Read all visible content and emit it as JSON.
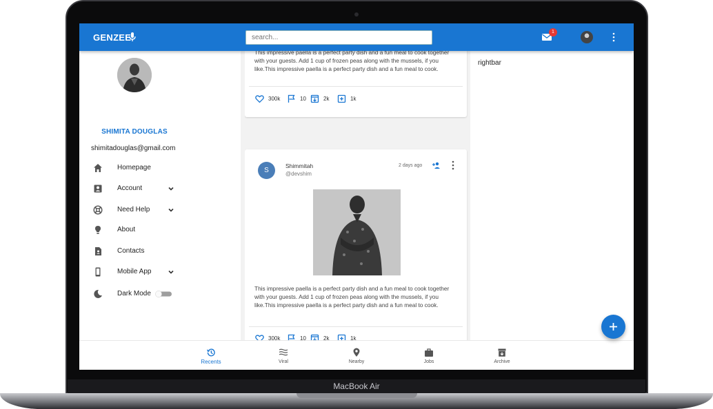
{
  "device": {
    "label": "MacBook Air"
  },
  "appbar": {
    "brand": "GENZEE",
    "search_placeholder": "search...",
    "mail_badge": "1"
  },
  "sidebar": {
    "name": "SHIMITA DOUGLAS",
    "email": "shimitadouglas@gmail.com",
    "items": [
      {
        "label": "Homepage",
        "icon": "home-icon",
        "expandable": false
      },
      {
        "label": "Account",
        "icon": "account-box-icon",
        "expandable": true
      },
      {
        "label": "Need Help",
        "icon": "help-buoy-icon",
        "expandable": true
      },
      {
        "label": "About",
        "icon": "lightbulb-icon",
        "expandable": false
      },
      {
        "label": "Contacts",
        "icon": "contact-file-icon",
        "expandable": false
      },
      {
        "label": "Mobile App",
        "icon": "smartphone-icon",
        "expandable": true
      },
      {
        "label": "Dark Mode",
        "icon": "moon-icon",
        "expandable": false
      }
    ]
  },
  "feed": {
    "post1": {
      "text": "This impressive paella is a perfect party dish and a fun meal to cook together with your guests. Add 1 cup of frozen peas along with the mussels, if you like.This impressive paella is a perfect party dish and a fun meal to cook.",
      "likes": "300k",
      "flags": "10",
      "saves": "2k",
      "adds": "1k"
    },
    "post2": {
      "avatar_letter": "S",
      "user": "Shimmitah",
      "handle": "@devshim",
      "time": "2 days ago",
      "text": "This impressive paella is a perfect party dish and a fun meal to cook together with your guests. Add 1 cup of frozen peas along with the mussels, if you like.This impressive paella is a perfect party dish and a fun meal to cook.",
      "likes": "300k",
      "flags": "10",
      "saves": "2k",
      "adds": "1k"
    }
  },
  "rightbar": {
    "label": "rightbar"
  },
  "bottomnav": {
    "items": [
      {
        "label": "Recents",
        "icon": "history-icon",
        "active": true
      },
      {
        "label": "Viral",
        "icon": "waves-icon",
        "active": false
      },
      {
        "label": "Nearby",
        "icon": "location-pin-icon",
        "active": false
      },
      {
        "label": "Jobs",
        "icon": "briefcase-icon",
        "active": false
      },
      {
        "label": "Archive",
        "icon": "archive-icon",
        "active": false
      }
    ]
  },
  "colors": {
    "primary": "#1976d2",
    "badge": "#e53935",
    "avatar": "#4a7eb8"
  }
}
